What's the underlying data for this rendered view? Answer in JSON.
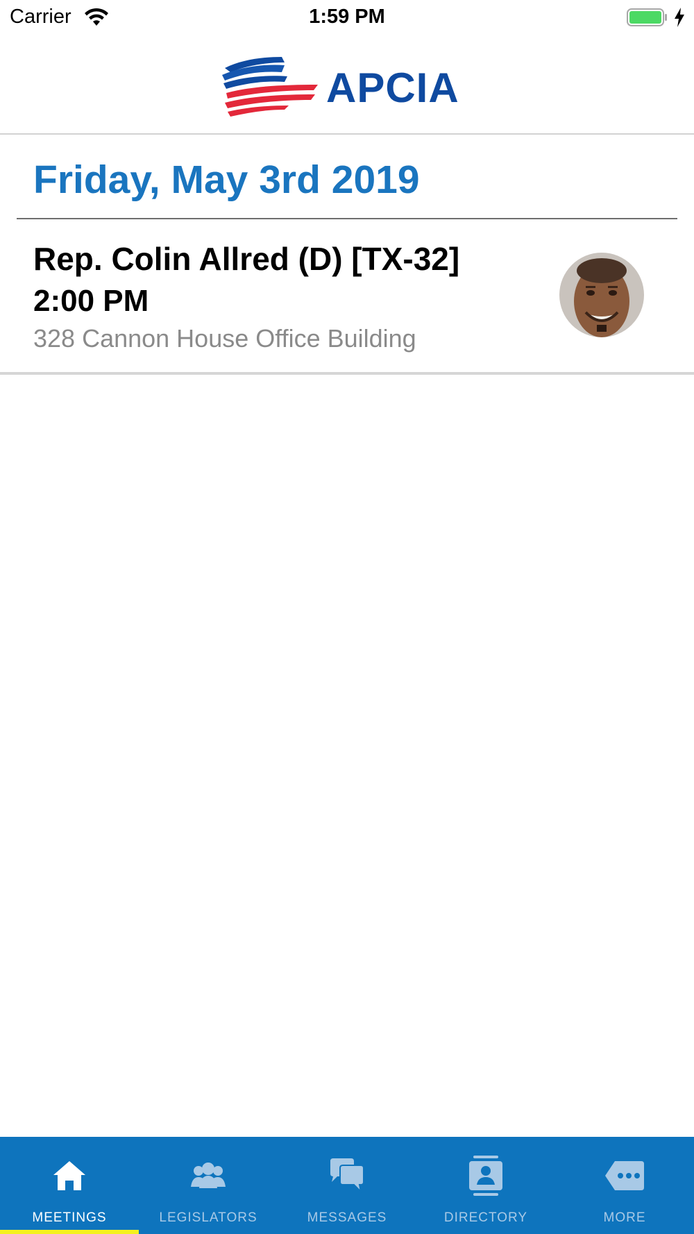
{
  "status_bar": {
    "carrier": "Carrier",
    "time": "1:59 PM"
  },
  "header": {
    "logo_text": "APCIA"
  },
  "meetings": {
    "date_heading": "Friday, May 3rd 2019",
    "items": [
      {
        "name": "Rep. Colin Allred (D) [TX-32]",
        "time": "2:00 PM",
        "location": "328 Cannon House Office Building"
      }
    ]
  },
  "tab_bar": {
    "active_indicator_color": "#f4f11e",
    "background_color": "#0e74bd",
    "tabs": [
      {
        "label": "MEETINGS",
        "icon": "home-icon",
        "active": true
      },
      {
        "label": "LEGISLATORS",
        "icon": "people-icon",
        "active": false
      },
      {
        "label": "MESSAGES",
        "icon": "chat-bubbles-icon",
        "active": false
      },
      {
        "label": "DIRECTORY",
        "icon": "contact-card-icon",
        "active": false
      },
      {
        "label": "MORE",
        "icon": "more-icon",
        "active": false
      }
    ]
  },
  "colors": {
    "date_heading": "#1a75bf",
    "logo_blue": "#0f4aa0",
    "logo_red": "#e3283a"
  }
}
